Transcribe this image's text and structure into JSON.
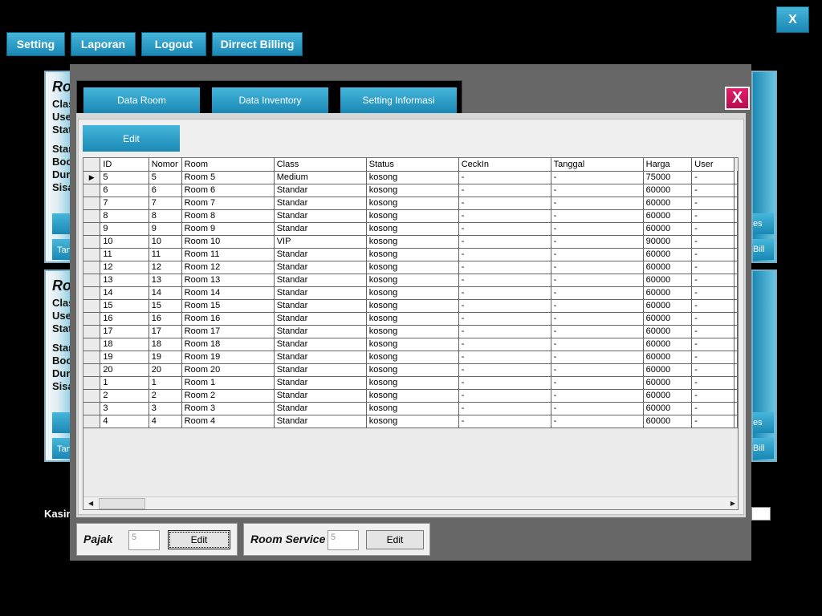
{
  "topnav": {
    "setting": "Setting",
    "laporan": "Laporan",
    "logout": "Logout",
    "direct_billing": "Dirrect Billing",
    "close": "X"
  },
  "background": {
    "card_title": "Ro",
    "line1": "Clas",
    "line2": "Use",
    "line3": "Stat",
    "line4": "Star",
    "line5": "Boo",
    "line6": "Dura",
    "line7": "Sisa",
    "btn_tan": "Tan",
    "right_es": "es",
    "right_bill": "Bill",
    "kasir_label": "Kasir"
  },
  "modal": {
    "close": "X",
    "tabs": [
      "Data Room",
      "Data Inventory",
      "Setting Informasi"
    ],
    "edit_label": "Edit"
  },
  "grid": {
    "columns": [
      "ID",
      "Nomor",
      "Room",
      "Class",
      "Status",
      "CeckIn",
      "Tanggal",
      "Harga",
      "User"
    ],
    "selected_marker": "▶",
    "rows": [
      [
        "5",
        "5",
        "Room 5",
        "Medium",
        "kosong",
        "-",
        "-",
        "75000",
        "-"
      ],
      [
        "6",
        "6",
        "Room 6",
        "Standar",
        "kosong",
        "-",
        "-",
        "60000",
        "-"
      ],
      [
        "7",
        "7",
        "Room 7",
        "Standar",
        "kosong",
        "-",
        "-",
        "60000",
        "-"
      ],
      [
        "8",
        "8",
        "Room 8",
        "Standar",
        "kosong",
        "-",
        "-",
        "60000",
        "-"
      ],
      [
        "9",
        "9",
        "Room 9",
        "Standar",
        "kosong",
        "-",
        "-",
        "60000",
        "-"
      ],
      [
        "10",
        "10",
        "Room 10",
        "VIP",
        "kosong",
        "-",
        "-",
        "90000",
        "-"
      ],
      [
        "11",
        "11",
        "Room 11",
        "Standar",
        "kosong",
        "-",
        "-",
        "60000",
        "-"
      ],
      [
        "12",
        "12",
        "Room 12",
        "Standar",
        "kosong",
        "-",
        "-",
        "60000",
        "-"
      ],
      [
        "13",
        "13",
        "Room 13",
        "Standar",
        "kosong",
        "-",
        "-",
        "60000",
        "-"
      ],
      [
        "14",
        "14",
        "Room 14",
        "Standar",
        "kosong",
        "-",
        "-",
        "60000",
        "-"
      ],
      [
        "15",
        "15",
        "Room 15",
        "Standar",
        "kosong",
        "-",
        "-",
        "60000",
        "-"
      ],
      [
        "16",
        "16",
        "Room 16",
        "Standar",
        "kosong",
        "-",
        "-",
        "60000",
        "-"
      ],
      [
        "17",
        "17",
        "Room 17",
        "Standar",
        "kosong",
        "-",
        "-",
        "60000",
        "-"
      ],
      [
        "18",
        "18",
        "Room 18",
        "Standar",
        "kosong",
        "-",
        "-",
        "60000",
        "-"
      ],
      [
        "19",
        "19",
        "Room 19",
        "Standar",
        "kosong",
        "-",
        "-",
        "60000",
        "-"
      ],
      [
        "20",
        "20",
        "Room 20",
        "Standar",
        "kosong",
        "-",
        "-",
        "60000",
        "-"
      ],
      [
        "1",
        "1",
        "Room 1",
        "Standar",
        "kosong",
        "-",
        "-",
        "60000",
        "-"
      ],
      [
        "2",
        "2",
        "Room 2",
        "Standar",
        "kosong",
        "-",
        "-",
        "60000",
        "-"
      ],
      [
        "3",
        "3",
        "Room 3",
        "Standar",
        "kosong",
        "-",
        "-",
        "60000",
        "-"
      ],
      [
        "4",
        "4",
        "Room 4",
        "Standar",
        "kosong",
        "-",
        "-",
        "60000",
        "-"
      ]
    ]
  },
  "settings": {
    "pajak_label": "Pajak",
    "pajak_value": "5",
    "pajak_edit": "Edit",
    "room_service_label": "Room Service",
    "room_service_value": "5",
    "room_service_edit": "Edit"
  }
}
